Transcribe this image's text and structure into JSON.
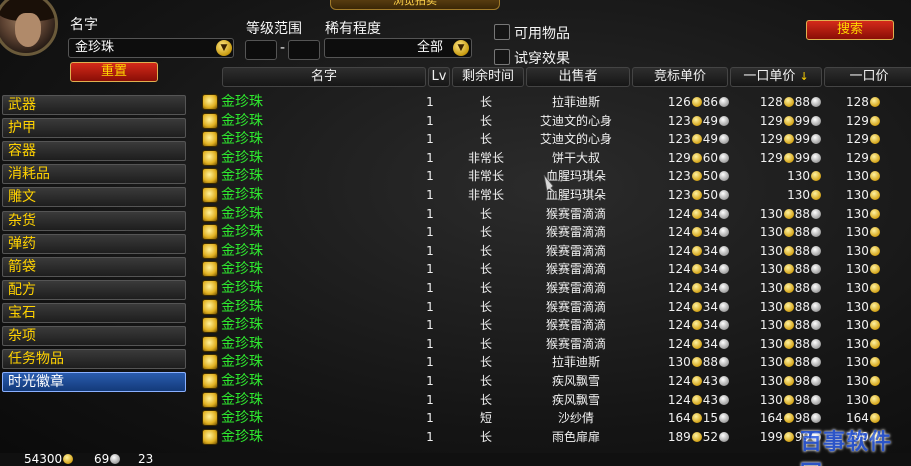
{
  "window_title": "浏览拍卖",
  "search": {
    "name_label": "名字",
    "name_value": "金珍珠",
    "level_label": "等级范围",
    "level_dash": "-",
    "rarity_label": "稀有程度",
    "rarity_value": "全部",
    "usable_label": "可用物品",
    "tryon_label": "试穿效果",
    "search_button": "搜索",
    "reset_button": "重置"
  },
  "columns": {
    "name": "名字",
    "lv": "Lv",
    "time": "剩余时间",
    "seller": "出售者",
    "bid": "竞标单价",
    "buyout_unit": "一口单价",
    "buyout_unit_sort": "↓",
    "buyout": "一口价"
  },
  "categories": [
    {
      "label": "武器",
      "selected": false
    },
    {
      "label": "护甲",
      "selected": false
    },
    {
      "label": "容器",
      "selected": false
    },
    {
      "label": "消耗品",
      "selected": false
    },
    {
      "label": "雕文",
      "selected": false
    },
    {
      "label": "杂货",
      "selected": false
    },
    {
      "label": "弹药",
      "selected": false
    },
    {
      "label": "箭袋",
      "selected": false
    },
    {
      "label": "配方",
      "selected": false
    },
    {
      "label": "宝石",
      "selected": false
    },
    {
      "label": "杂项",
      "selected": false
    },
    {
      "label": "任务物品",
      "selected": false
    },
    {
      "label": "时光徽章",
      "selected": true
    }
  ],
  "rows": [
    {
      "name": "金珍珠",
      "lv": "1",
      "time": "长",
      "seller": "拉菲迪斯",
      "bid_g": "126",
      "bid_s": "86",
      "bo_g": "128",
      "bo_s": "88",
      "bo2_g": "128"
    },
    {
      "name": "金珍珠",
      "lv": "1",
      "time": "长",
      "seller": "艾迪文的心身",
      "bid_g": "123",
      "bid_s": "49",
      "bo_g": "129",
      "bo_s": "99",
      "bo2_g": "129"
    },
    {
      "name": "金珍珠",
      "lv": "1",
      "time": "长",
      "seller": "艾迪文的心身",
      "bid_g": "123",
      "bid_s": "49",
      "bo_g": "129",
      "bo_s": "99",
      "bo2_g": "129"
    },
    {
      "name": "金珍珠",
      "lv": "1",
      "time": "非常长",
      "seller": "饼干大叔",
      "bid_g": "129",
      "bid_s": "60",
      "bo_g": "129",
      "bo_s": "99",
      "bo2_g": "129"
    },
    {
      "name": "金珍珠",
      "lv": "1",
      "time": "非常长",
      "seller": "血腥玛琪朵",
      "bid_g": "123",
      "bid_s": "50",
      "bo_g": "130",
      "bo_s": "",
      "bo2_g": "130"
    },
    {
      "name": "金珍珠",
      "lv": "1",
      "time": "非常长",
      "seller": "血腥玛琪朵",
      "bid_g": "123",
      "bid_s": "50",
      "bo_g": "130",
      "bo_s": "",
      "bo2_g": "130"
    },
    {
      "name": "金珍珠",
      "lv": "1",
      "time": "长",
      "seller": "猴赛雷滴滴",
      "bid_g": "124",
      "bid_s": "34",
      "bo_g": "130",
      "bo_s": "88",
      "bo2_g": "130"
    },
    {
      "name": "金珍珠",
      "lv": "1",
      "time": "长",
      "seller": "猴赛雷滴滴",
      "bid_g": "124",
      "bid_s": "34",
      "bo_g": "130",
      "bo_s": "88",
      "bo2_g": "130"
    },
    {
      "name": "金珍珠",
      "lv": "1",
      "time": "长",
      "seller": "猴赛雷滴滴",
      "bid_g": "124",
      "bid_s": "34",
      "bo_g": "130",
      "bo_s": "88",
      "bo2_g": "130"
    },
    {
      "name": "金珍珠",
      "lv": "1",
      "time": "长",
      "seller": "猴赛雷滴滴",
      "bid_g": "124",
      "bid_s": "34",
      "bo_g": "130",
      "bo_s": "88",
      "bo2_g": "130"
    },
    {
      "name": "金珍珠",
      "lv": "1",
      "time": "长",
      "seller": "猴赛雷滴滴",
      "bid_g": "124",
      "bid_s": "34",
      "bo_g": "130",
      "bo_s": "88",
      "bo2_g": "130"
    },
    {
      "name": "金珍珠",
      "lv": "1",
      "time": "长",
      "seller": "猴赛雷滴滴",
      "bid_g": "124",
      "bid_s": "34",
      "bo_g": "130",
      "bo_s": "88",
      "bo2_g": "130"
    },
    {
      "name": "金珍珠",
      "lv": "1",
      "time": "长",
      "seller": "猴赛雷滴滴",
      "bid_g": "124",
      "bid_s": "34",
      "bo_g": "130",
      "bo_s": "88",
      "bo2_g": "130"
    },
    {
      "name": "金珍珠",
      "lv": "1",
      "time": "长",
      "seller": "猴赛雷滴滴",
      "bid_g": "124",
      "bid_s": "34",
      "bo_g": "130",
      "bo_s": "88",
      "bo2_g": "130"
    },
    {
      "name": "金珍珠",
      "lv": "1",
      "time": "长",
      "seller": "拉菲迪斯",
      "bid_g": "130",
      "bid_s": "88",
      "bo_g": "130",
      "bo_s": "88",
      "bo2_g": "130"
    },
    {
      "name": "金珍珠",
      "lv": "1",
      "time": "长",
      "seller": "疾风飘雪",
      "bid_g": "124",
      "bid_s": "43",
      "bo_g": "130",
      "bo_s": "98",
      "bo2_g": "130"
    },
    {
      "name": "金珍珠",
      "lv": "1",
      "time": "长",
      "seller": "疾风飘雪",
      "bid_g": "124",
      "bid_s": "43",
      "bo_g": "130",
      "bo_s": "98",
      "bo2_g": "130"
    },
    {
      "name": "金珍珠",
      "lv": "1",
      "time": "短",
      "seller": "沙纱倩",
      "bid_g": "164",
      "bid_s": "15",
      "bo_g": "164",
      "bo_s": "98",
      "bo2_g": "164"
    },
    {
      "name": "金珍珠",
      "lv": "1",
      "time": "长",
      "seller": "雨色扉扉",
      "bid_g": "189",
      "bid_s": "52",
      "bo_g": "199",
      "bo_s": "99",
      "bo2_g": "199"
    }
  ],
  "footer": {
    "gold": "54300",
    "silver": "69",
    "copper": "23"
  },
  "watermark": "百事软件园",
  "colors": {
    "item_name": "#2ee82e",
    "category_text": "#ffd200",
    "selected_category": "#2a5cae",
    "button_red": "#b81a10"
  }
}
